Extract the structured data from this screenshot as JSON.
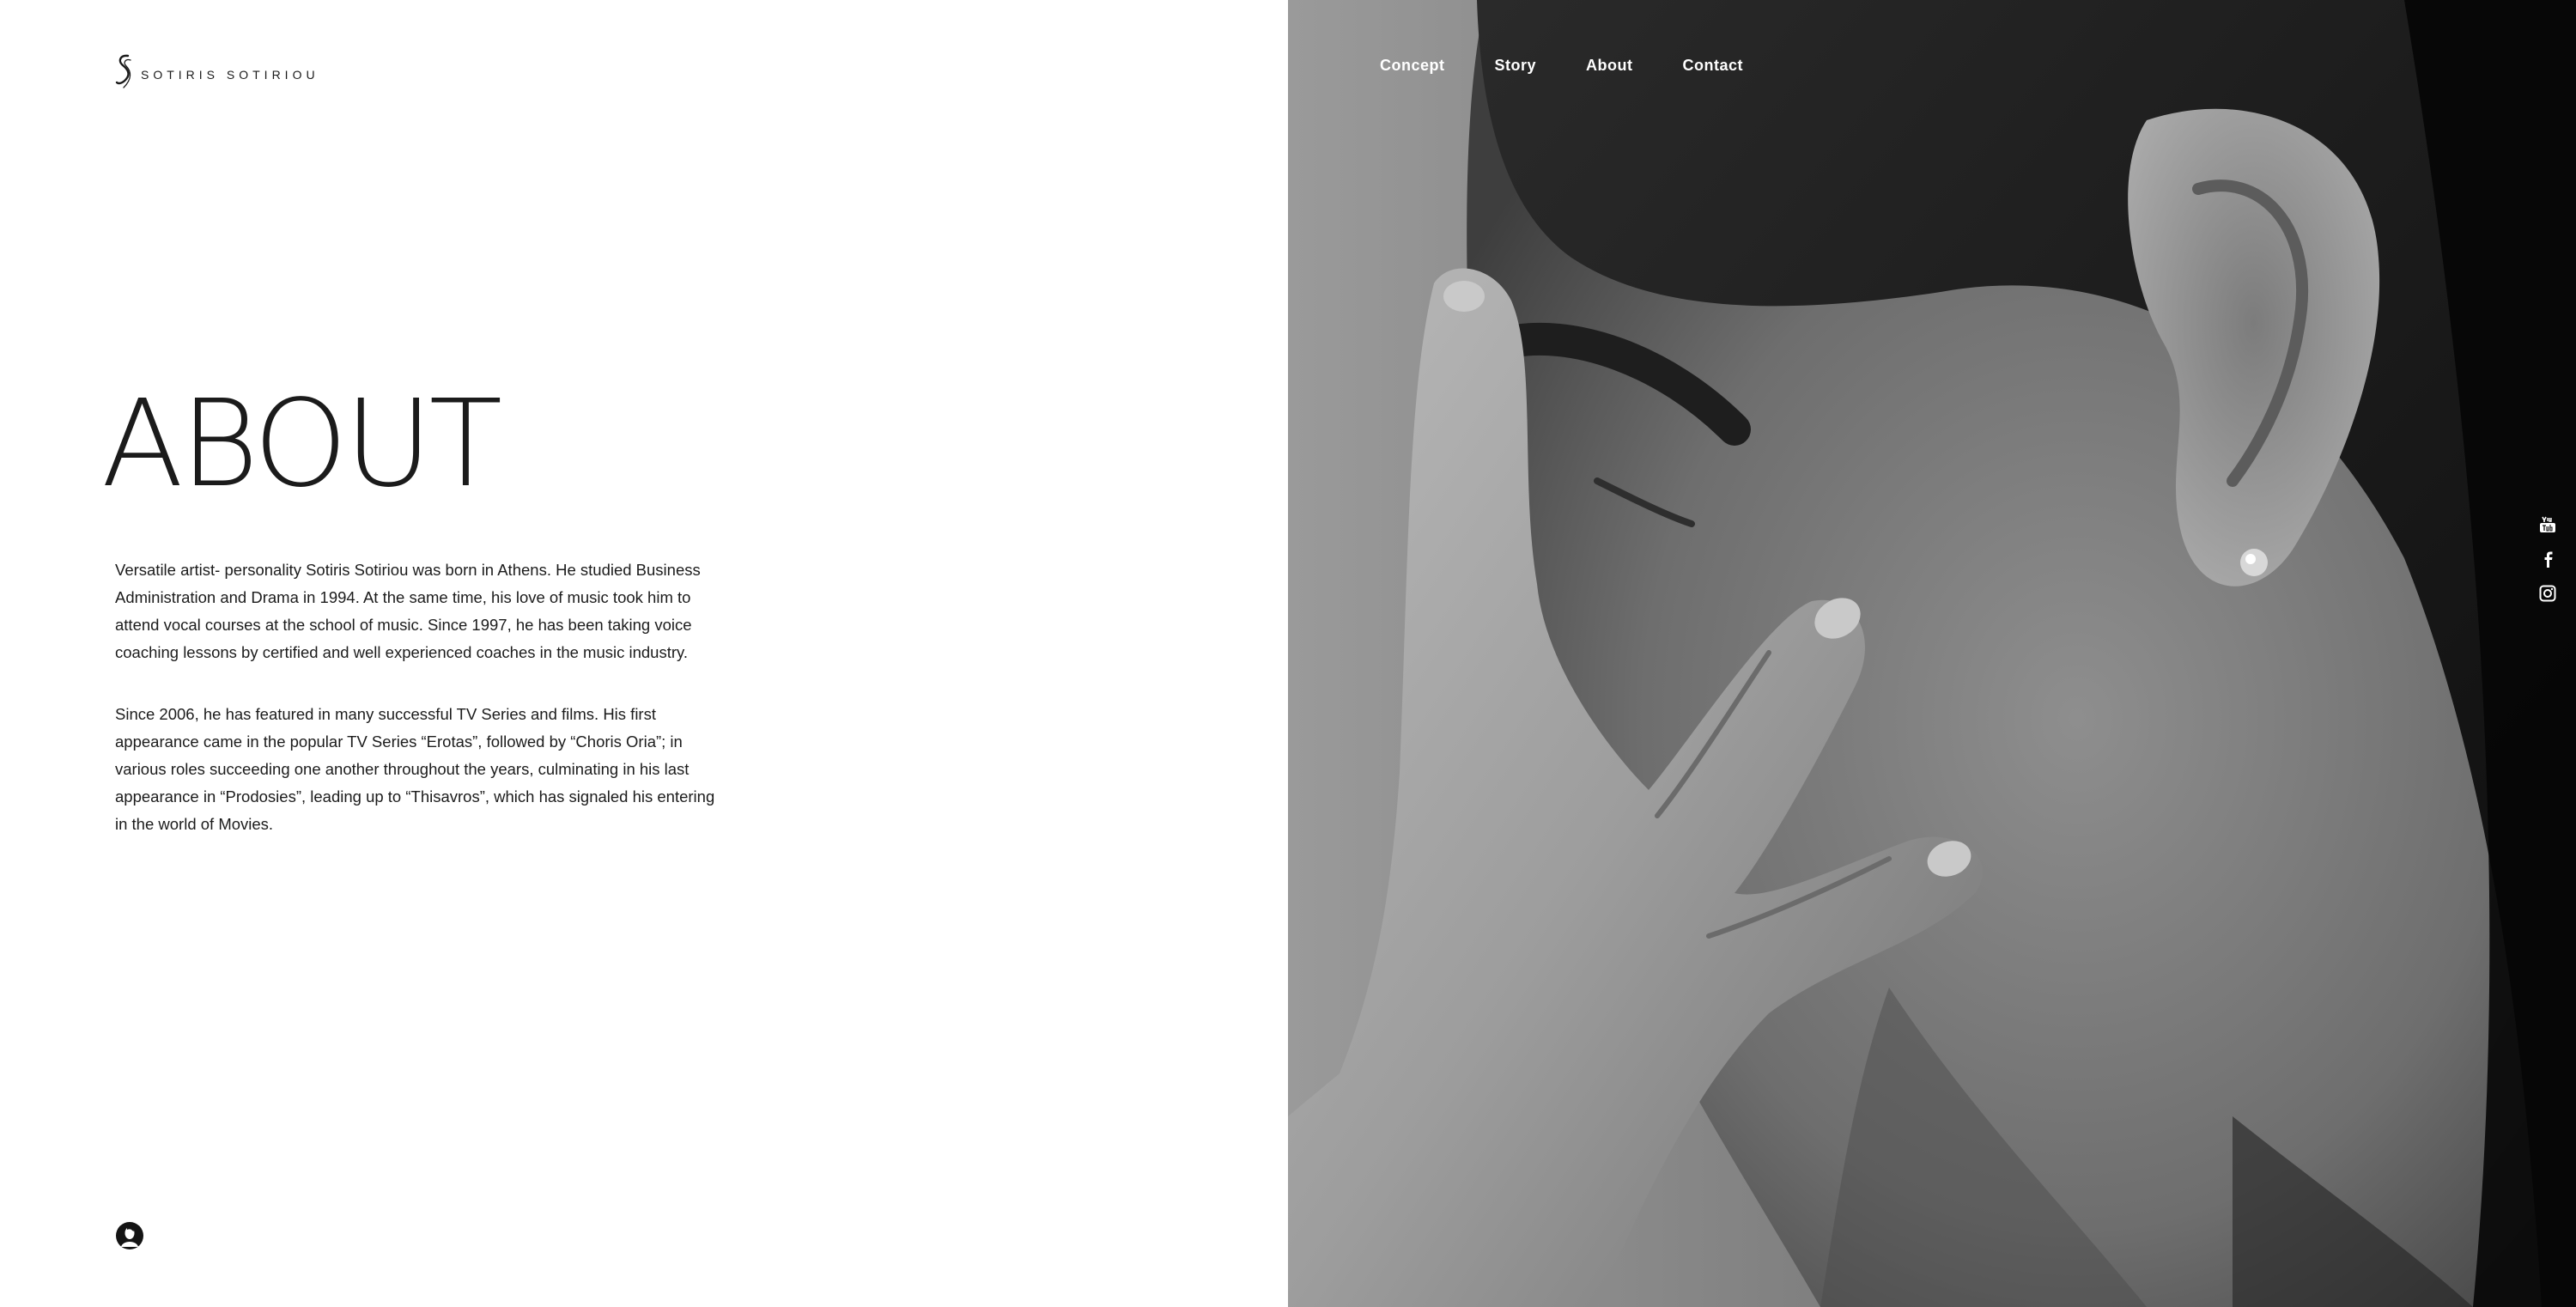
{
  "brand": {
    "name": "Sotiris Sotiriou"
  },
  "nav": {
    "items": [
      {
        "label": "Concept"
      },
      {
        "label": "Story"
      },
      {
        "label": "About"
      },
      {
        "label": "Contact"
      }
    ]
  },
  "main": {
    "title": "ABOUT",
    "paragraphs": [
      "Versatile artist- personality Sotiris Sotiriou was born in Athens. He studied Business Administration and Drama in 1994. At the same time, his love of music took him to attend vocal courses at the school of music. Since 1997, he has been taking voice coaching lessons by certified and well experienced coaches in the music industry.",
      "Since 2006, he has featured in many successful TV Series and films. His first appearance came in the popular TV Series “Erotas”, followed by “Choris Oria”; in various roles succeeding one another throughout the years, culminating in his last appearance in “Prodosies”, leading up to “Thisavros”, which has signaled his entering in the world of Movies."
    ]
  },
  "social": {
    "icons": [
      "youtube-icon",
      "facebook-icon",
      "instagram-icon"
    ]
  },
  "colors": {
    "text": "#1b1b1b",
    "background": "#ffffff",
    "nav_text": "#ffffff"
  }
}
